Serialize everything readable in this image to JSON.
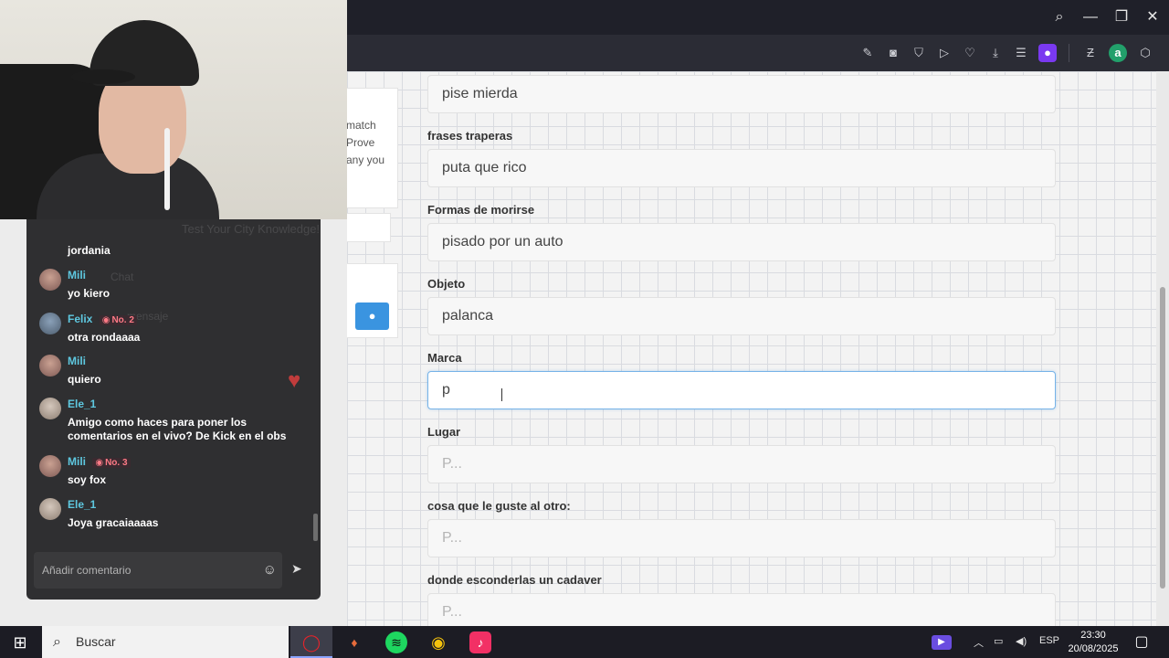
{
  "browser": {
    "toolbar_icons": [
      "edit-icon",
      "camera-icon",
      "shield-icon",
      "play-icon",
      "heart-icon",
      "download-icon",
      "menu-icon",
      "profile-icon",
      "extension-z-icon",
      "extension-a-icon",
      "cube-icon"
    ]
  },
  "left_panel": {
    "lines": [
      "match",
      "Prove",
      "any you"
    ],
    "hint": "Test Your City Knowledge!"
  },
  "form": {
    "fields": [
      {
        "label": "",
        "value": "pise mierda",
        "placeholder": ""
      },
      {
        "label": "frases traperas",
        "value": "puta que rico",
        "placeholder": ""
      },
      {
        "label": "Formas de morirse",
        "value": "pisado por un auto",
        "placeholder": ""
      },
      {
        "label": "Objeto",
        "value": "palanca",
        "placeholder": ""
      },
      {
        "label": "Marca",
        "value": "p",
        "placeholder": ""
      },
      {
        "label": "Lugar",
        "value": "",
        "placeholder": "P..."
      },
      {
        "label": "cosa que le guste al otro:",
        "value": "",
        "placeholder": "P..."
      },
      {
        "label": "donde esconderlas un cadaver",
        "value": "",
        "placeholder": "P..."
      }
    ]
  },
  "chat": {
    "messages": [
      {
        "user": "",
        "text": "jordania"
      },
      {
        "user": "Mili",
        "text": "yo kiero"
      },
      {
        "user": "Felix",
        "badge": "No. 2",
        "text": "otra rondaaaa"
      },
      {
        "user": "Mili",
        "text": "quiero"
      },
      {
        "user": "Ele_1",
        "text": "Amigo como haces para poner los comentarios en el vivo? De Kick en el obs"
      },
      {
        "user": "Mili",
        "badge": "No. 3",
        "text": "soy fox"
      },
      {
        "user": "Ele_1",
        "text": "Joya gracaiaaaas"
      }
    ],
    "ghost": [
      "Chat",
      "mensaje"
    ],
    "input_placeholder": "Añadir comentario"
  },
  "taskbar": {
    "search_label": "Buscar",
    "language": "ESP",
    "time": "23:30",
    "date": "20/08/2025"
  },
  "colors": {
    "accent_focus": "#76b3e8",
    "chat_username": "#5ec8e0",
    "profile_button": "#7a39f0",
    "send_button": "#3a94e0"
  }
}
